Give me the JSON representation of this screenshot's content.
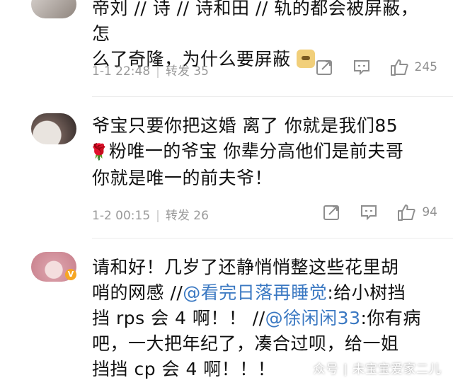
{
  "comments": [
    {
      "text_lines": [
        "帝刘 // 诗 // 诗和田 // 轨的都会被屏蔽，怎",
        "么了奇隆，为什么要屏蔽"
      ],
      "date": "1-1 22:48",
      "repost_label": "转发 35",
      "likes": "245"
    },
    {
      "text_lines": [
        "爷宝只要你把这婚 离了 你就是我们85",
        "粉唯一的爷宝 你辈分高他们是前夫哥",
        "你就是唯一的前夫爷！"
      ],
      "date": "1-2 00:15",
      "repost_label": "转发 26",
      "likes": "94"
    },
    {
      "line1": "请和好！几岁了还静悄悄整这些花里胡",
      "line2_a": "哨的网感 //",
      "line2_mention": "@看完日落再睡觉",
      "line2_b": ":给小树挡",
      "line3_a": "挡 rps 会 4 啊！！ //",
      "line3_mention": "@徐闲闲33",
      "line3_b": ":你有病",
      "line4": "吧，一大把年纪了，凑合过呗，给一姐",
      "line5": "挡挡 cp 会 4 啊！！！"
    }
  ],
  "badge": "V",
  "watermark": "众号 | 未宝宝爱家二儿",
  "colors": {
    "mention": "#3a78c2",
    "meta": "#9a9a9a",
    "text": "#111111"
  },
  "icons": [
    "repost-icon",
    "comment-icon",
    "like-icon"
  ]
}
